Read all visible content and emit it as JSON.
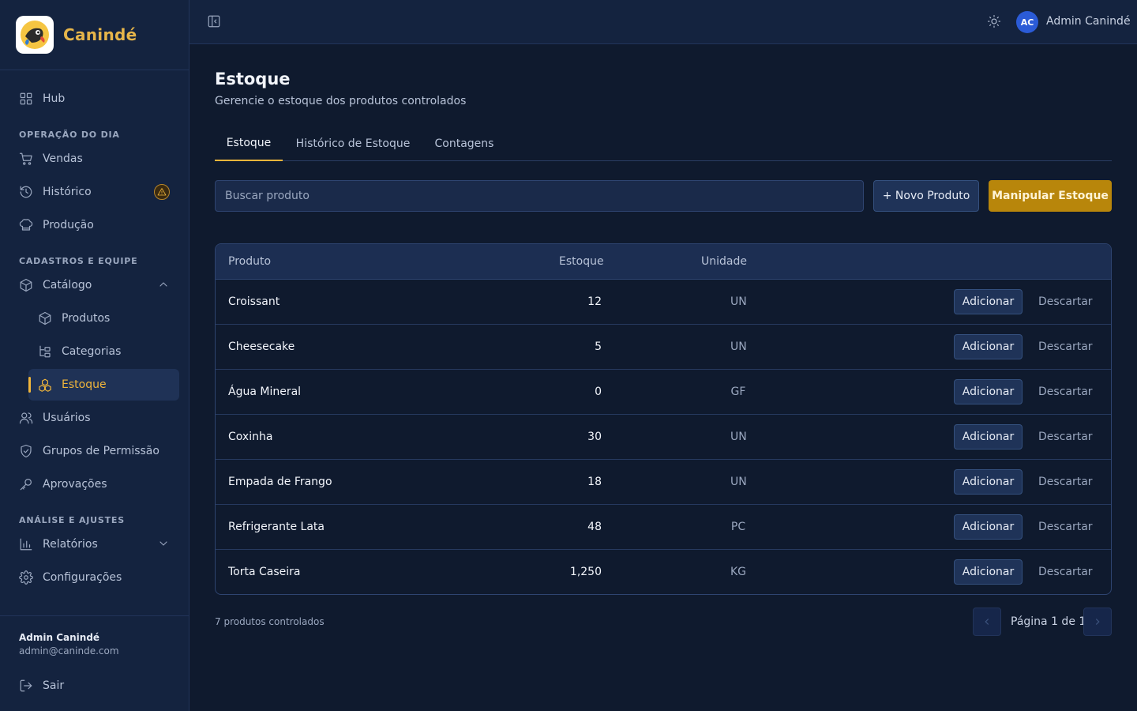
{
  "brand": {
    "name": "Canindé"
  },
  "sidebar": {
    "hub": "Hub",
    "section_operacao": "OPERAÇÃO DO DIA",
    "vendas": "Vendas",
    "historico": "Histórico",
    "producao": "Produção",
    "section_cadastros": "CADASTROS E EQUIPE",
    "catalogo": "Catálogo",
    "produtos": "Produtos",
    "categorias": "Categorias",
    "estoque": "Estoque",
    "usuarios": "Usuários",
    "grupos": "Grupos de Permissão",
    "aprovacoes": "Aprovações",
    "section_analise": "ANÁLISE E AJUSTES",
    "relatorios": "Relatórios",
    "configuracoes": "Configurações",
    "user_name": "Admin Canindé",
    "user_email": "admin@caninde.com",
    "logout": "Sair"
  },
  "topbar": {
    "avatar_initials": "AC",
    "user_name": "Admin Canindé"
  },
  "page": {
    "title": "Estoque",
    "subtitle": "Gerencie o estoque dos produtos controlados",
    "tabs": [
      "Estoque",
      "Histórico de Estoque",
      "Contagens"
    ],
    "search_placeholder": "Buscar produto",
    "new_product": "+ Novo Produto",
    "manipulate": "Manipular Estoque"
  },
  "table": {
    "headers": {
      "product": "Produto",
      "stock": "Estoque",
      "unit": "Unidade"
    },
    "add_label": "Adicionar",
    "discard_label": "Descartar",
    "rows": [
      {
        "name": "Croissant",
        "qty": "12",
        "unit": "UN"
      },
      {
        "name": "Cheesecake",
        "qty": "5",
        "unit": "UN"
      },
      {
        "name": "Água Mineral",
        "qty": "0",
        "unit": "GF"
      },
      {
        "name": "Coxinha",
        "qty": "30",
        "unit": "UN"
      },
      {
        "name": "Empada de Frango",
        "qty": "18",
        "unit": "UN"
      },
      {
        "name": "Refrigerante Lata",
        "qty": "48",
        "unit": "PC"
      },
      {
        "name": "Torta Caseira",
        "qty": "1,250",
        "unit": "KG"
      }
    ]
  },
  "footer": {
    "count": "7 produtos controlados",
    "page_label": "Página 1 de 1"
  },
  "colors": {
    "accent": "#f0b53b",
    "bg": "#0f1a2e",
    "sidebar": "#14233f",
    "primary_btn": "#b8860b",
    "avatar": "#2b5bd7"
  }
}
